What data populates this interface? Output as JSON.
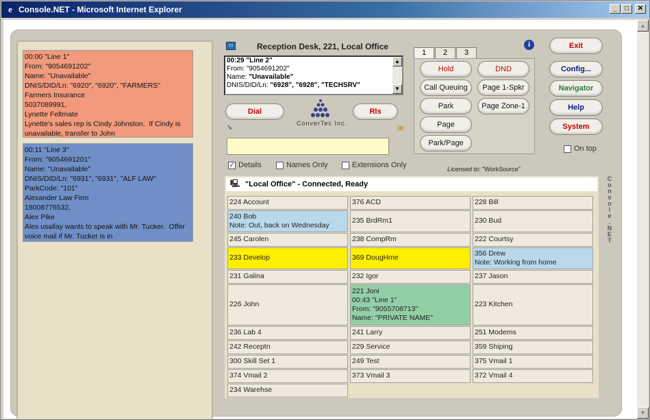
{
  "window": {
    "title": "Console.NET - Microsoft Internet Explorer"
  },
  "colors": {
    "call1": "#f29a7d",
    "call2": "#6f8fc6",
    "yellow": "#ffef00",
    "lightblue": "#b9d8ec",
    "green": "#93cfa6",
    "exit_red": "#c00000",
    "navigator_green": "#2a7a3a"
  },
  "calls": [
    {
      "text": "00:00 \"Line 1\"\nFrom: \"9054691202\"\nName: \"Unavailable\"\nDNIS/DID/Ln: \"6920\", \"6920\", \"FARMERS\"\nFarmers Insurance\n5037089991,\nLynette Feltmate\nLynette's sales rep is Cindy Johnston.  If Cindy is unavailable, transfer to John"
    },
    {
      "text": "00:11 \"Line 3\"\nFrom: \"9054691201\"\nName: \"Unavailable\"\nDNIS/DID/Ln: \"6931\", \"6931\", \"ALF LAW\"\nParkCode: \"101\"\nAlexander Law Firm\n18008776532,\nAlex Pike\nAlex usallay wants to speak with Mr. Tucker.  Offer voice mail if Mr. Tucker is in"
    }
  ],
  "reception": {
    "title": "Reception Desk,   221, Local Office",
    "line1": "00:29 \"Line 2\"",
    "line2": "From: \"9054691202\"",
    "line3_label": "Name: ",
    "line3_val": "\"Unavailable\"",
    "line4_label": "DNIS/DID/Ln: ",
    "line4_val": "\"6928\", \"6928\", \"TECHSRV\"",
    "dial": "Dial",
    "rls": "Rls",
    "logo_text": "ConverTec Inc."
  },
  "tabs": [
    "1",
    "2",
    "3"
  ],
  "buttons": {
    "hold": "Hold",
    "dnd": "DND",
    "call_queuing": "Call Queuing",
    "page1": "Page 1-Spkr",
    "park": "Park",
    "page_zone": "Page Zone-1",
    "page": "Page",
    "park_page": "Park/Page"
  },
  "right_buttons": {
    "exit": "Exit",
    "config": "Config...",
    "navigator": "Navigator",
    "help": "Help",
    "system": "System"
  },
  "ontop": "On top",
  "options": {
    "details": "Details",
    "names_only": "Names Only",
    "extensions_only": "Extensions Only"
  },
  "licensed_label": "Licensed to:",
  "licensed_value": "\"WorkSource\"",
  "grid_header": "\"Local Office\" - Connected, Ready",
  "side_text": "Console.NET",
  "extensions": [
    "224 Account",
    "376 ACD",
    "228 Bill",
    "240 Bob\nNote: Out, back on Wednesday",
    "235 BrdRm1",
    "230 Bud",
    "245 Carolen",
    "238 CompRm",
    "222 Courtsy",
    "233 Develop",
    "369 DougHme",
    "356 Drew\nNote: Working from home",
    "231 Galina",
    "232 Igor",
    "237 Jason",
    "226 John",
    "221 Joni\n00:43 \"Line 1\"\nFrom: \"9055708713\"\nName: \"PRIVATE NAME\"",
    "223 Kitchen",
    "236 Lab 4",
    "241 Larry",
    "251 Modems",
    "242 Receptn",
    "229 Service",
    "359 Shiping",
    "300 Skill Set 1",
    "249 Test",
    "375 Vmail 1",
    "374 Vmail 2",
    "373 Vmail 3",
    "372 Vmail 4",
    "234 Warehse"
  ]
}
